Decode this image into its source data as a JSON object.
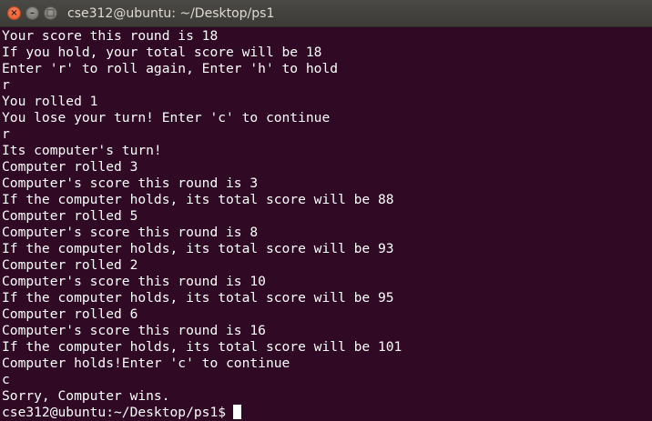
{
  "window": {
    "title": "cse312@ubuntu: ~/Desktop/ps1",
    "close_icon": "close-icon",
    "minimize_icon": "minimize-icon",
    "maximize_icon": "maximize-icon"
  },
  "terminal": {
    "background": "#300a24",
    "foreground": "#ffffff",
    "lines": [
      "Your score this round is 18",
      "If you hold, your total score will be 18",
      "Enter 'r' to roll again, Enter 'h' to hold",
      "r",
      "You rolled 1",
      "You lose your turn! Enter 'c' to continue",
      "r",
      "Its computer's turn!",
      "Computer rolled 3",
      "Computer's score this round is 3",
      "If the computer holds, its total score will be 88",
      "Computer rolled 5",
      "Computer's score this round is 8",
      "If the computer holds, its total score will be 93",
      "Computer rolled 2",
      "Computer's score this round is 10",
      "If the computer holds, its total score will be 95",
      "Computer rolled 6",
      "Computer's score this round is 16",
      "If the computer holds, its total score will be 101",
      "Computer holds!Enter 'c' to continue",
      "c",
      "Sorry, Computer wins."
    ],
    "prompt": "cse312@ubuntu:~/Desktop/ps1$"
  }
}
